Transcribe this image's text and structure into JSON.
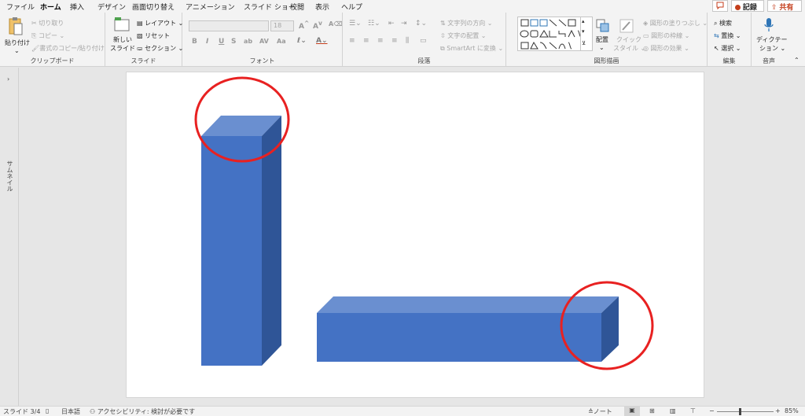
{
  "tabs": [
    "ファイル",
    "ホーム",
    "挿入",
    "デザイン",
    "画面切り替え",
    "アニメーション",
    "スライド ショー",
    "校閲",
    "表示",
    "ヘルプ"
  ],
  "active_tab": "ホーム",
  "title_actions": {
    "comment_icon": "comment-icon",
    "record": "記録",
    "share": "共有"
  },
  "clipboard": {
    "paste": "貼り付け",
    "cut": "切り取り",
    "copy": "コピー",
    "format_painter": "書式のコピー/貼り付け",
    "group": "クリップボード"
  },
  "slides": {
    "new_slide": "新しい\nスライド",
    "new_slide_line1": "新しい",
    "new_slide_line2": "スライド",
    "layout": "レイアウト",
    "reset": "リセット",
    "section": "セクション",
    "group": "スライド"
  },
  "font": {
    "font_size": "18",
    "bold": "B",
    "italic": "I",
    "underline": "U",
    "strike": "S",
    "group": "フォント"
  },
  "paragraph": {
    "text_direction": "文字列の方向",
    "align_text": "文字の配置",
    "smartart": "SmartArt に変換",
    "group": "段落"
  },
  "drawing": {
    "arrange": "配置",
    "quick_styles_1": "クイック",
    "quick_styles_2": "スタイル",
    "fill": "図形の塗りつぶし",
    "outline": "図形の枠線",
    "effects": "図形の効果",
    "group": "図形描画"
  },
  "editing": {
    "find": "検索",
    "replace": "置換",
    "select": "選択",
    "group": "編集"
  },
  "voice": {
    "dictate_1": "ディクテー",
    "dictate_2": "ション",
    "group": "音声"
  },
  "sidebar": {
    "label": "サムネイル"
  },
  "status": {
    "slide_counter": "スライド 3/4",
    "language": "日本語",
    "accessibility": "アクセシビリティ: 検討が必要です",
    "notes": "ノート",
    "zoom": "85%"
  },
  "colors": {
    "accent": "#c43e1c",
    "shape_front": "#4472c4",
    "shape_top": "#6a8fd0",
    "shape_side": "#2f5597",
    "circle": "#ff0000"
  }
}
